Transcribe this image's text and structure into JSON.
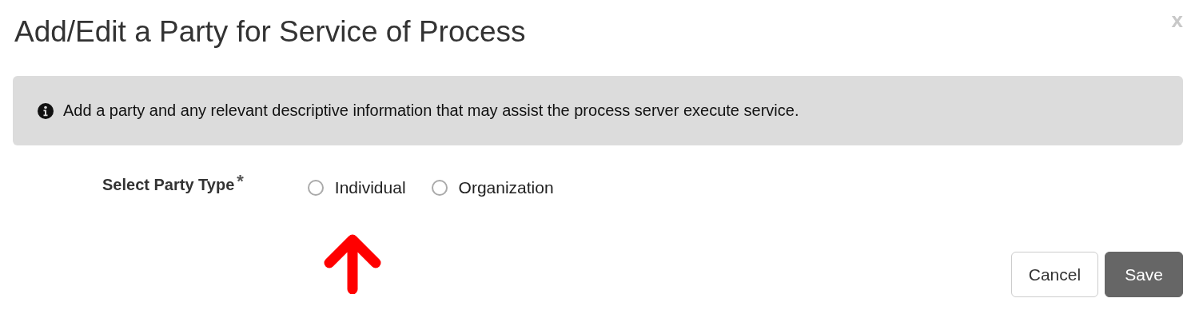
{
  "dialog": {
    "title": "Add/Edit a Party for Service of Process",
    "close": "x"
  },
  "info": {
    "text": "Add a party and any relevant descriptive information that may assist the process server execute service."
  },
  "party_type": {
    "label": "Select Party Type",
    "required_mark": "*",
    "options": [
      {
        "label": "Individual",
        "selected": false
      },
      {
        "label": "Organization",
        "selected": false
      }
    ]
  },
  "annotation": {
    "kind": "arrow",
    "color": "#ff0000"
  },
  "buttons": [
    {
      "label": "Cancel",
      "kind": "default"
    },
    {
      "label": "Save",
      "kind": "primary"
    }
  ]
}
